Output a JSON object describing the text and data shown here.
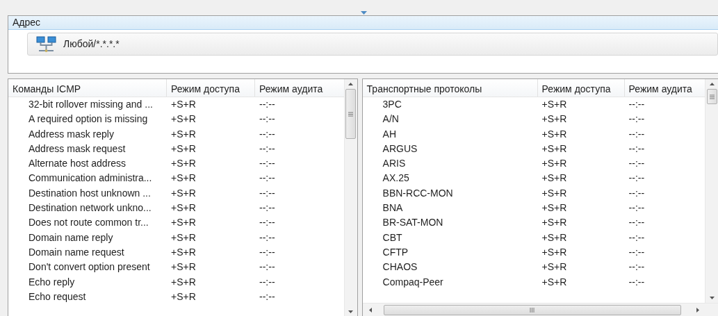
{
  "address_panel": {
    "title": "Адрес",
    "entries": [
      {
        "label": "Любой/*.*.*.*"
      }
    ]
  },
  "tables": [
    {
      "columns": [
        "Команды ICMP",
        "Режим доступа",
        "Режим аудита"
      ],
      "rows": [
        [
          "32-bit rollover missing and ...",
          "+S+R",
          "--:--"
        ],
        [
          "A required option is missing",
          "+S+R",
          "--:--"
        ],
        [
          "Address mask reply",
          "+S+R",
          "--:--"
        ],
        [
          "Address mask request",
          "+S+R",
          "--:--"
        ],
        [
          "Alternate host address",
          "+S+R",
          "--:--"
        ],
        [
          "Communication administra...",
          "+S+R",
          "--:--"
        ],
        [
          "Destination host unknown ...",
          "+S+R",
          "--:--"
        ],
        [
          "Destination network unkno...",
          "+S+R",
          "--:--"
        ],
        [
          "Does not route common tr...",
          "+S+R",
          "--:--"
        ],
        [
          "Domain name reply",
          "+S+R",
          "--:--"
        ],
        [
          "Domain name request",
          "+S+R",
          "--:--"
        ],
        [
          "Don't convert option present",
          "+S+R",
          "--:--"
        ],
        [
          "Echo reply",
          "+S+R",
          "--:--"
        ],
        [
          "Echo request",
          "+S+R",
          "--:--"
        ]
      ]
    },
    {
      "columns": [
        "Транспортные протоколы",
        "Режим доступа",
        "Режим аудита"
      ],
      "rows": [
        [
          "3PC",
          "+S+R",
          "--:--"
        ],
        [
          "A/N",
          "+S+R",
          "--:--"
        ],
        [
          "AH",
          "+S+R",
          "--:--"
        ],
        [
          "ARGUS",
          "+S+R",
          "--:--"
        ],
        [
          "ARIS",
          "+S+R",
          "--:--"
        ],
        [
          "AX.25",
          "+S+R",
          "--:--"
        ],
        [
          "BBN-RCC-MON",
          "+S+R",
          "--:--"
        ],
        [
          "BNA",
          "+S+R",
          "--:--"
        ],
        [
          "BR-SAT-MON",
          "+S+R",
          "--:--"
        ],
        [
          "CBT",
          "+S+R",
          "--:--"
        ],
        [
          "CFTP",
          "+S+R",
          "--:--"
        ],
        [
          "CHAOS",
          "+S+R",
          "--:--"
        ],
        [
          "Compaq-Peer",
          "+S+R",
          "--:--"
        ]
      ]
    }
  ]
}
